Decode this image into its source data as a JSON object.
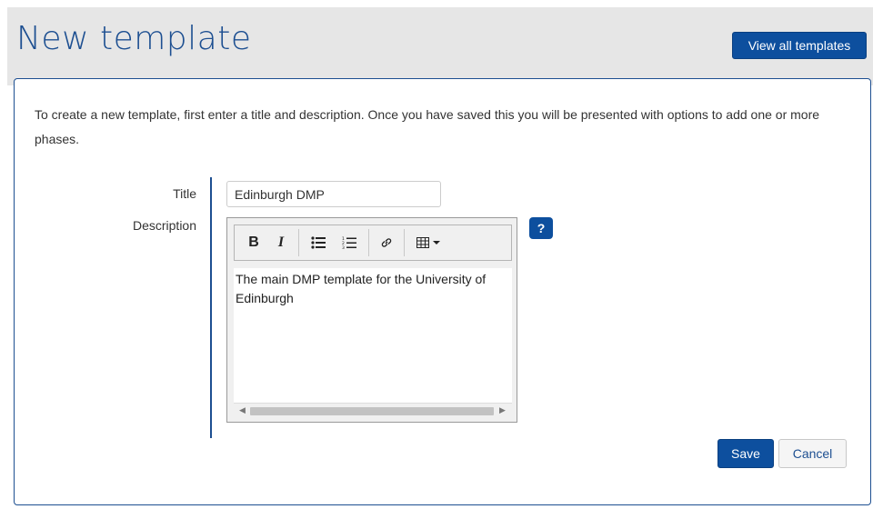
{
  "header": {
    "title": "New template",
    "view_all_label": "View all templates"
  },
  "intro_text": "To create a new template, first enter a title and description. Once you have saved this you will be presented with options to add one or more phases.",
  "form": {
    "title_label": "Title",
    "title_value": "Edinburgh DMP",
    "description_label": "Description",
    "description_value": "The main DMP template for the University of Edinburgh",
    "help_label": "?"
  },
  "toolbar": {
    "bold": "B",
    "italic": "I",
    "bullet_list_icon": "bullet-list-icon",
    "numbered_list_icon": "numbered-list-icon",
    "link_icon": "link-icon",
    "table_icon": "table-icon"
  },
  "actions": {
    "save_label": "Save",
    "cancel_label": "Cancel"
  },
  "colors": {
    "brand": "#0d4f9e",
    "title": "#1d4f91",
    "band": "#e6e6e6"
  }
}
